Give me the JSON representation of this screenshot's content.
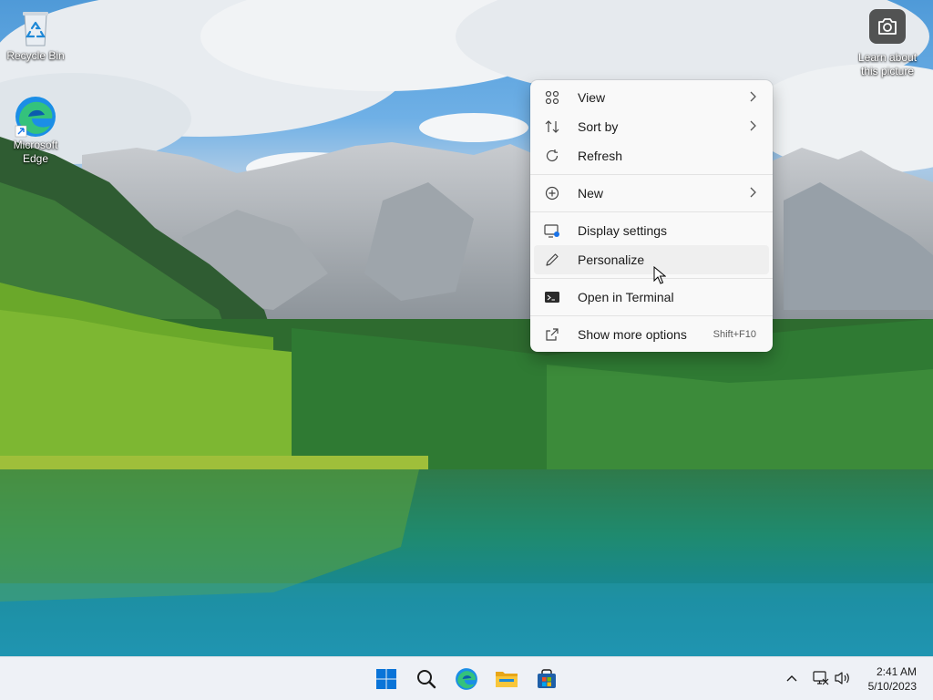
{
  "desktop": {
    "icons": [
      {
        "label": "Recycle Bin",
        "icon": "recycle-bin-icon"
      },
      {
        "label": "Microsoft Edge",
        "icon": "edge-icon"
      }
    ],
    "spotlight": {
      "label": "Learn about this picture",
      "icon": "camera-icon"
    }
  },
  "context_menu": {
    "items": [
      {
        "label": "View",
        "icon": "grid-icon",
        "submenu": true
      },
      {
        "label": "Sort by",
        "icon": "sort-icon",
        "submenu": true
      },
      {
        "label": "Refresh",
        "icon": "refresh-icon"
      },
      {
        "label": "New",
        "icon": "plus-circle-icon",
        "submenu": true
      },
      {
        "label": "Display settings",
        "icon": "display-settings-icon"
      },
      {
        "label": "Personalize",
        "icon": "pen-icon"
      },
      {
        "label": "Open in Terminal",
        "icon": "terminal-icon"
      },
      {
        "label": "Show more options",
        "icon": "share-icon",
        "shortcut": "Shift+F10"
      }
    ]
  },
  "taskbar": {
    "pinned": [
      {
        "name": "Start",
        "icon": "windows-logo-icon"
      },
      {
        "name": "Search",
        "icon": "search-icon"
      },
      {
        "name": "Microsoft Edge",
        "icon": "edge-icon"
      },
      {
        "name": "File Explorer",
        "icon": "folder-icon"
      },
      {
        "name": "Microsoft Store",
        "icon": "store-icon"
      }
    ],
    "tray": {
      "icons": [
        "chevron-up-icon",
        "network-icon",
        "volume-icon"
      ],
      "time": "2:41 AM",
      "date": "5/10/2023"
    }
  },
  "colors": {
    "accent": "#0067c0",
    "taskbar": "#eef1f6",
    "menu_bg": "#f9f9f9"
  }
}
